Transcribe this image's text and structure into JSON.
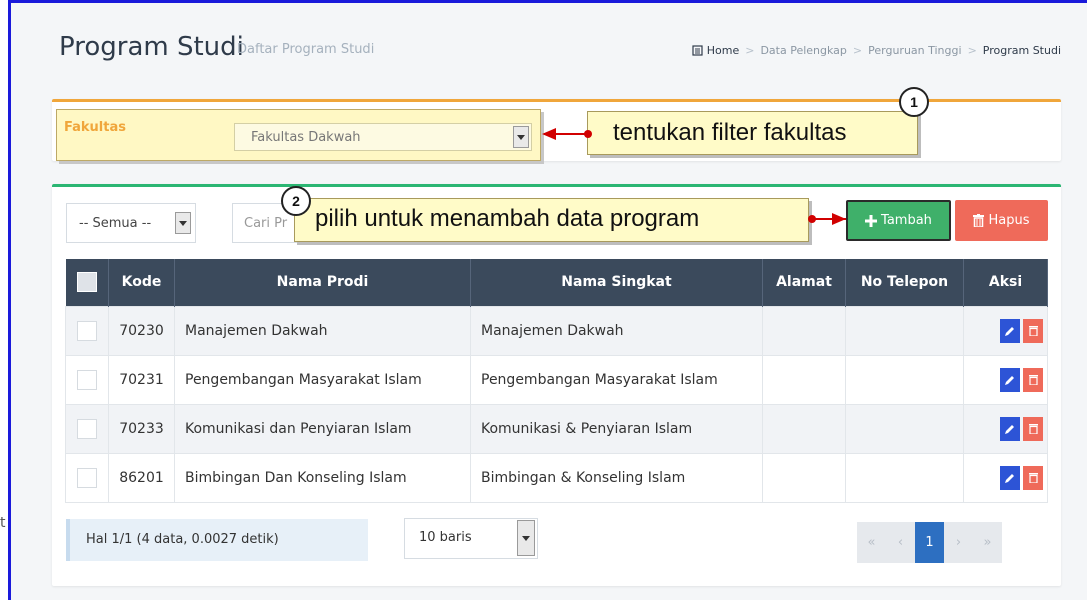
{
  "header": {
    "title": "Program Studi",
    "subtitle": "Daftar Program Studi",
    "breadcrumb": [
      "Home",
      "Data Pelengkap",
      "Perguruan Tinggi",
      "Program Studi"
    ]
  },
  "filter": {
    "label": "Fakultas",
    "value": "Fakultas Dakwah"
  },
  "annotations": {
    "badge1": "1",
    "callout1": "tentukan filter fakultas",
    "badge2": "2",
    "callout2": "pilih untuk menambah data program"
  },
  "toolbar": {
    "status_filter": "-- Semua --",
    "search_placeholder": "Cari Pr",
    "add_label": "Tambah",
    "delete_label": "Hapus"
  },
  "table": {
    "columns": [
      "Kode",
      "Nama Prodi",
      "Nama Singkat",
      "Alamat",
      "No Telepon",
      "Aksi"
    ],
    "rows": [
      {
        "kode": "70230",
        "nama": "Manajemen Dakwah",
        "singkat": "Manajemen Dakwah",
        "alamat": "",
        "telepon": ""
      },
      {
        "kode": "70231",
        "nama": "Pengembangan Masyarakat Islam",
        "singkat": "Pengembangan Masyarakat Islam",
        "alamat": "",
        "telepon": ""
      },
      {
        "kode": "70233",
        "nama": "Komunikasi dan Penyiaran Islam",
        "singkat": "Komunikasi & Penyiaran Islam",
        "alamat": "",
        "telepon": ""
      },
      {
        "kode": "86201",
        "nama": "Bimbingan Dan Konseling Islam",
        "singkat": "Bimbingan & Konseling Islam",
        "alamat": "",
        "telepon": ""
      }
    ]
  },
  "footer": {
    "page_info": "Hal 1/1 (4 data, 0.0027 detik)",
    "rows_per_page": "10 baris",
    "pager": [
      "«",
      "‹",
      "1",
      "›",
      "»"
    ],
    "current_page": "1"
  },
  "stray_text": "t",
  "colors": {
    "frame": "#1a1adb",
    "header_bg": "#3b4a5c",
    "add_button": "#3fb06a",
    "delete_button": "#ef6a5a",
    "filter_accent": "#f0a63b",
    "active_page": "#2d6fc1"
  }
}
